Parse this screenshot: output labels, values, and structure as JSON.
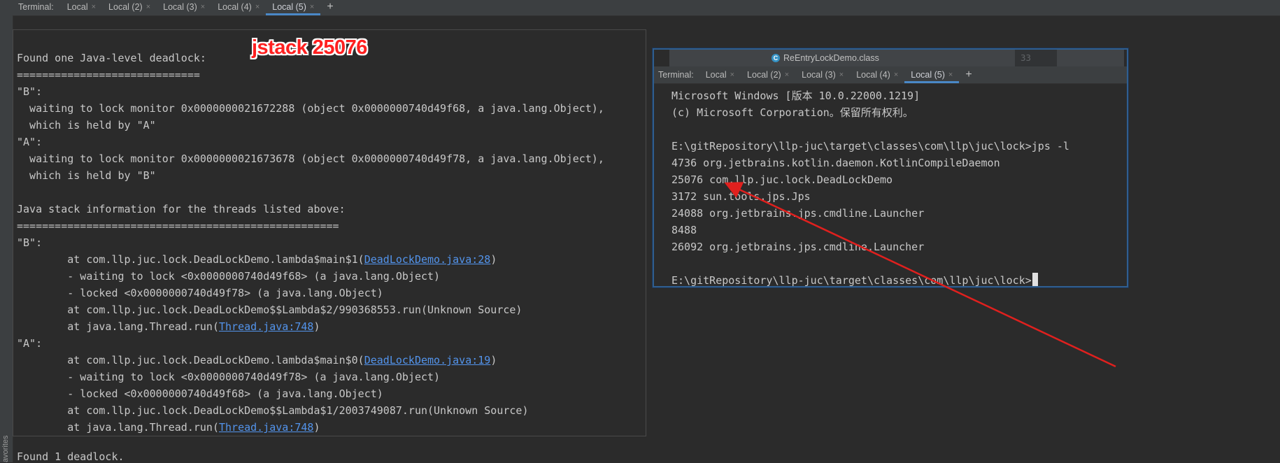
{
  "top_tabbar": {
    "label": "Terminal:",
    "tabs": [
      "Local",
      "Local (2)",
      "Local (3)",
      "Local (4)",
      "Local (5)"
    ],
    "active_index": 4,
    "close_glyph": "×",
    "add_glyph": "+"
  },
  "favorites_label": "avorites",
  "annotation": "jstack 25076",
  "main_terminal": {
    "l1": "Found one Java-level deadlock:",
    "l2": "=============================",
    "l3": "\"B\":",
    "l4": "  waiting to lock monitor 0x0000000021672288 (object 0x0000000740d49f68, a java.lang.Object),",
    "l5": "  which is held by \"A\"",
    "l6": "\"A\":",
    "l7": "  waiting to lock monitor 0x0000000021673678 (object 0x0000000740d49f78, a java.lang.Object),",
    "l8": "  which is held by \"B\"",
    "l10": "Java stack information for the threads listed above:",
    "l11": "===================================================",
    "l12": "\"B\":",
    "l13_pre": "        at com.llp.juc.lock.DeadLockDemo.lambda$main$1(",
    "l13_link": "DeadLockDemo.java:28",
    "l13_post": ")",
    "l14": "        - waiting to lock <0x0000000740d49f68> (a java.lang.Object)",
    "l15": "        - locked <0x0000000740d49f78> (a java.lang.Object)",
    "l16": "        at com.llp.juc.lock.DeadLockDemo$$Lambda$2/990368553.run(Unknown Source)",
    "l17_pre": "        at java.lang.Thread.run(",
    "l17_link": "Thread.java:748",
    "l17_post": ")",
    "l18": "\"A\":",
    "l19_pre": "        at com.llp.juc.lock.DeadLockDemo.lambda$main$0(",
    "l19_link": "DeadLockDemo.java:19",
    "l19_post": ")",
    "l20": "        - waiting to lock <0x0000000740d49f78> (a java.lang.Object)",
    "l21": "        - locked <0x0000000740d49f68> (a java.lang.Object)",
    "l22": "        at com.llp.juc.lock.DeadLockDemo$$Lambda$1/2003749087.run(Unknown Source)",
    "l23_pre": "        at java.lang.Thread.run(",
    "l23_link": "Thread.java:748",
    "l23_post": ")",
    "tail": "Found 1 deadlock."
  },
  "inset_panel": {
    "file_tab": "ReEntryLockDemo.class",
    "line_number": "33",
    "tab_label": "Terminal:",
    "tabs": [
      "Local",
      "Local (2)",
      "Local (3)",
      "Local (4)",
      "Local (5)"
    ],
    "active_index": 4,
    "lines": [
      "Microsoft Windows [版本 10.0.22000.1219]",
      "(c) Microsoft Corporation。保留所有权利。",
      "",
      "E:\\gitRepository\\llp-juc\\target\\classes\\com\\llp\\juc\\lock>jps -l",
      "4736 org.jetbrains.kotlin.daemon.KotlinCompileDaemon",
      "25076 com.llp.juc.lock.DeadLockDemo",
      "3172 sun.tools.jps.Jps",
      "24088 org.jetbrains.jps.cmdline.Launcher",
      "8488",
      "26092 org.jetbrains.jps.cmdline.Launcher",
      "",
      "E:\\gitRepository\\llp-juc\\target\\classes\\com\\llp\\juc\\lock>"
    ]
  },
  "colors": {
    "background": "#2b2b2b",
    "text": "#c8c8c8",
    "link": "#5394ec",
    "annotation": "#ff2020",
    "arrow": "#e0201e",
    "active_tab_underline": "#4a88c7"
  }
}
